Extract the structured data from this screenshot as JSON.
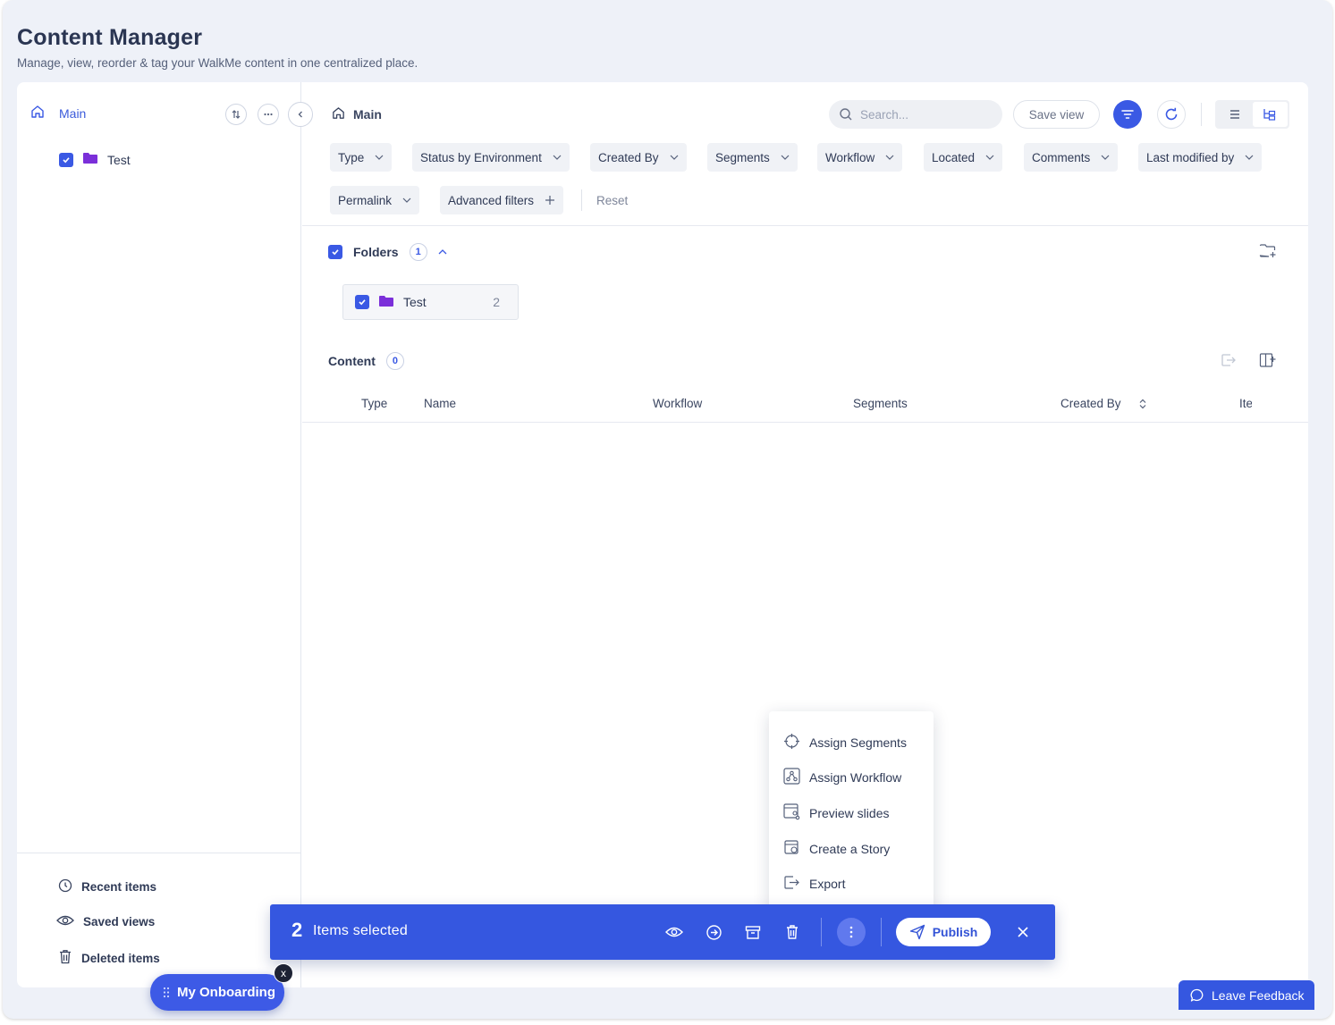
{
  "page": {
    "title": "Content Manager",
    "subtitle": "Manage, view, reorder & tag your WalkMe content in one centralized place."
  },
  "sidebar": {
    "root_label": "Main",
    "tree": [
      {
        "label": "Test",
        "checked": true,
        "icon": "folder-icon"
      }
    ],
    "bottom_links": [
      {
        "label": "Recent items",
        "icon": "clock-icon"
      },
      {
        "label": "Saved views",
        "icon": "eye-icon"
      },
      {
        "label": "Deleted items",
        "icon": "trash-icon"
      }
    ]
  },
  "main": {
    "breadcrumb": "Main",
    "search_placeholder": "Search...",
    "save_view_label": "Save view",
    "filters": [
      "Type",
      "Status by Environment",
      "Created By",
      "Segments",
      "Workflow",
      "Located",
      "Comments",
      "Last modified by",
      "Permalink"
    ],
    "advanced_filters_label": "Advanced filters",
    "reset_label": "Reset",
    "folders": {
      "title": "Folders",
      "count": "1",
      "items": [
        {
          "label": "Test",
          "count": "2",
          "checked": true
        }
      ]
    },
    "content": {
      "title": "Content",
      "count": "0",
      "columns": [
        "Type",
        "Name",
        "Workflow",
        "Segments",
        "Created By",
        "Ite"
      ]
    }
  },
  "action_bar": {
    "count": "2",
    "label": "Items selected",
    "publish_label": "Publish"
  },
  "more_menu": {
    "items": [
      {
        "label": "Assign Segments",
        "icon": "target-icon"
      },
      {
        "label": "Assign Workflow",
        "icon": "workflow-icon"
      },
      {
        "label": "Preview slides",
        "icon": "slides-icon"
      },
      {
        "label": "Create a Story",
        "icon": "story-icon"
      },
      {
        "label": "Export",
        "icon": "export-icon"
      }
    ]
  },
  "onboarding": {
    "label": "My Onboarding",
    "close_label": "x"
  },
  "feedback": {
    "label": "Leave Feedback"
  },
  "colors": {
    "accent": "#3557e0",
    "folder": "#7b2fd9",
    "background": "#eef1f8"
  }
}
